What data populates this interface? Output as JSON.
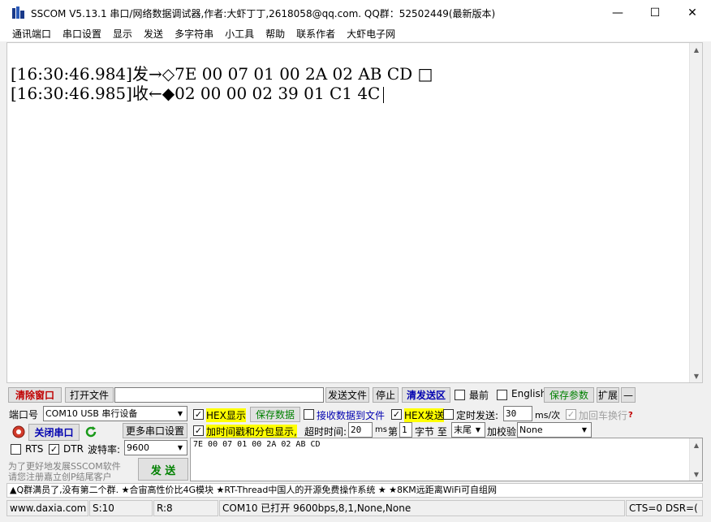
{
  "window": {
    "title": "SSCOM V5.13.1 串口/网络数据调试器,作者:大虾丁丁,2618058@qq.com. QQ群：52502449(最新版本)",
    "minimize": "—",
    "maximize": "☐",
    "close": "✕"
  },
  "menu": [
    "通讯端口",
    "串口设置",
    "显示",
    "发送",
    "多字符串",
    "小工具",
    "帮助",
    "联系作者",
    "大虾电子网"
  ],
  "receive": {
    "line1": "[16:30:46.984]发→◇7E 00 07 01 00 2A 02 AB CD □",
    "line2": "[16:30:46.985]收←◆02 00 00 02 39 01 C1 4C"
  },
  "toolbar": {
    "clear_window": "清除窗口",
    "open_file": "打开文件",
    "file_path": "",
    "send_file": "发送文件",
    "stop": "停止",
    "clear_send_area": "清发送区",
    "topmost": "最前",
    "english": "English",
    "save_params": "保存参数",
    "expand": "扩展",
    "collapse": "—"
  },
  "port": {
    "label": "端口号",
    "value": "COM10 USB 串行设备",
    "close_port": "关闭串口",
    "more_settings": "更多串口设置",
    "rts": "RTS",
    "dtr": "DTR",
    "rts_checked": false,
    "dtr_checked": true,
    "baud_label": "波特率:",
    "baud_value": "9600",
    "promo_line1": "为了更好地发展SSCOM软件",
    "promo_line2": "请您注册嘉立创P结尾客户",
    "send_button": "发  送"
  },
  "options": {
    "hex_display": "HEX显示",
    "hex_display_checked": true,
    "save_data": "保存数据",
    "recv_to_file": "接收数据到文件",
    "recv_to_file_checked": false,
    "hex_send": "HEX发送",
    "hex_send_checked": true,
    "timed_send": "定时发送:",
    "timed_send_checked": false,
    "timed_value": "30",
    "timed_unit": "ms/次",
    "add_crlf": "加回车换行",
    "add_crlf_checked": true,
    "timestamp": "加时间戳和分包显示,",
    "timestamp_checked": true,
    "timeout_label": "超时时间:",
    "timeout_value": "20",
    "timeout_unit": "ms",
    "byte_prefix": "第",
    "byte_value": "1",
    "byte_suffix": "字节 至",
    "end_value": "末尾",
    "checksum_label": "加校验",
    "checksum_value": "None"
  },
  "send_area": {
    "text": "7E 00 07 01 00 2A 02 AB CD"
  },
  "ticker": "▲Q群满员了,没有第二个群. ★合宙高性价比4G模块 ★RT-Thread中国人的开源免费操作系统 ★ ★8KM远距离WiFi可自组网",
  "status": {
    "website": "www.daxia.com",
    "sent": "S:10",
    "received": "R:8",
    "port_state": "COM10 已打开  9600bps,8,1,None,None",
    "signals": "CTS=0 DSR=("
  },
  "colors": {
    "highlight": "#ffff00",
    "green_text": "#008000",
    "blue_text": "#0000b0",
    "red_text": "#c00000"
  }
}
